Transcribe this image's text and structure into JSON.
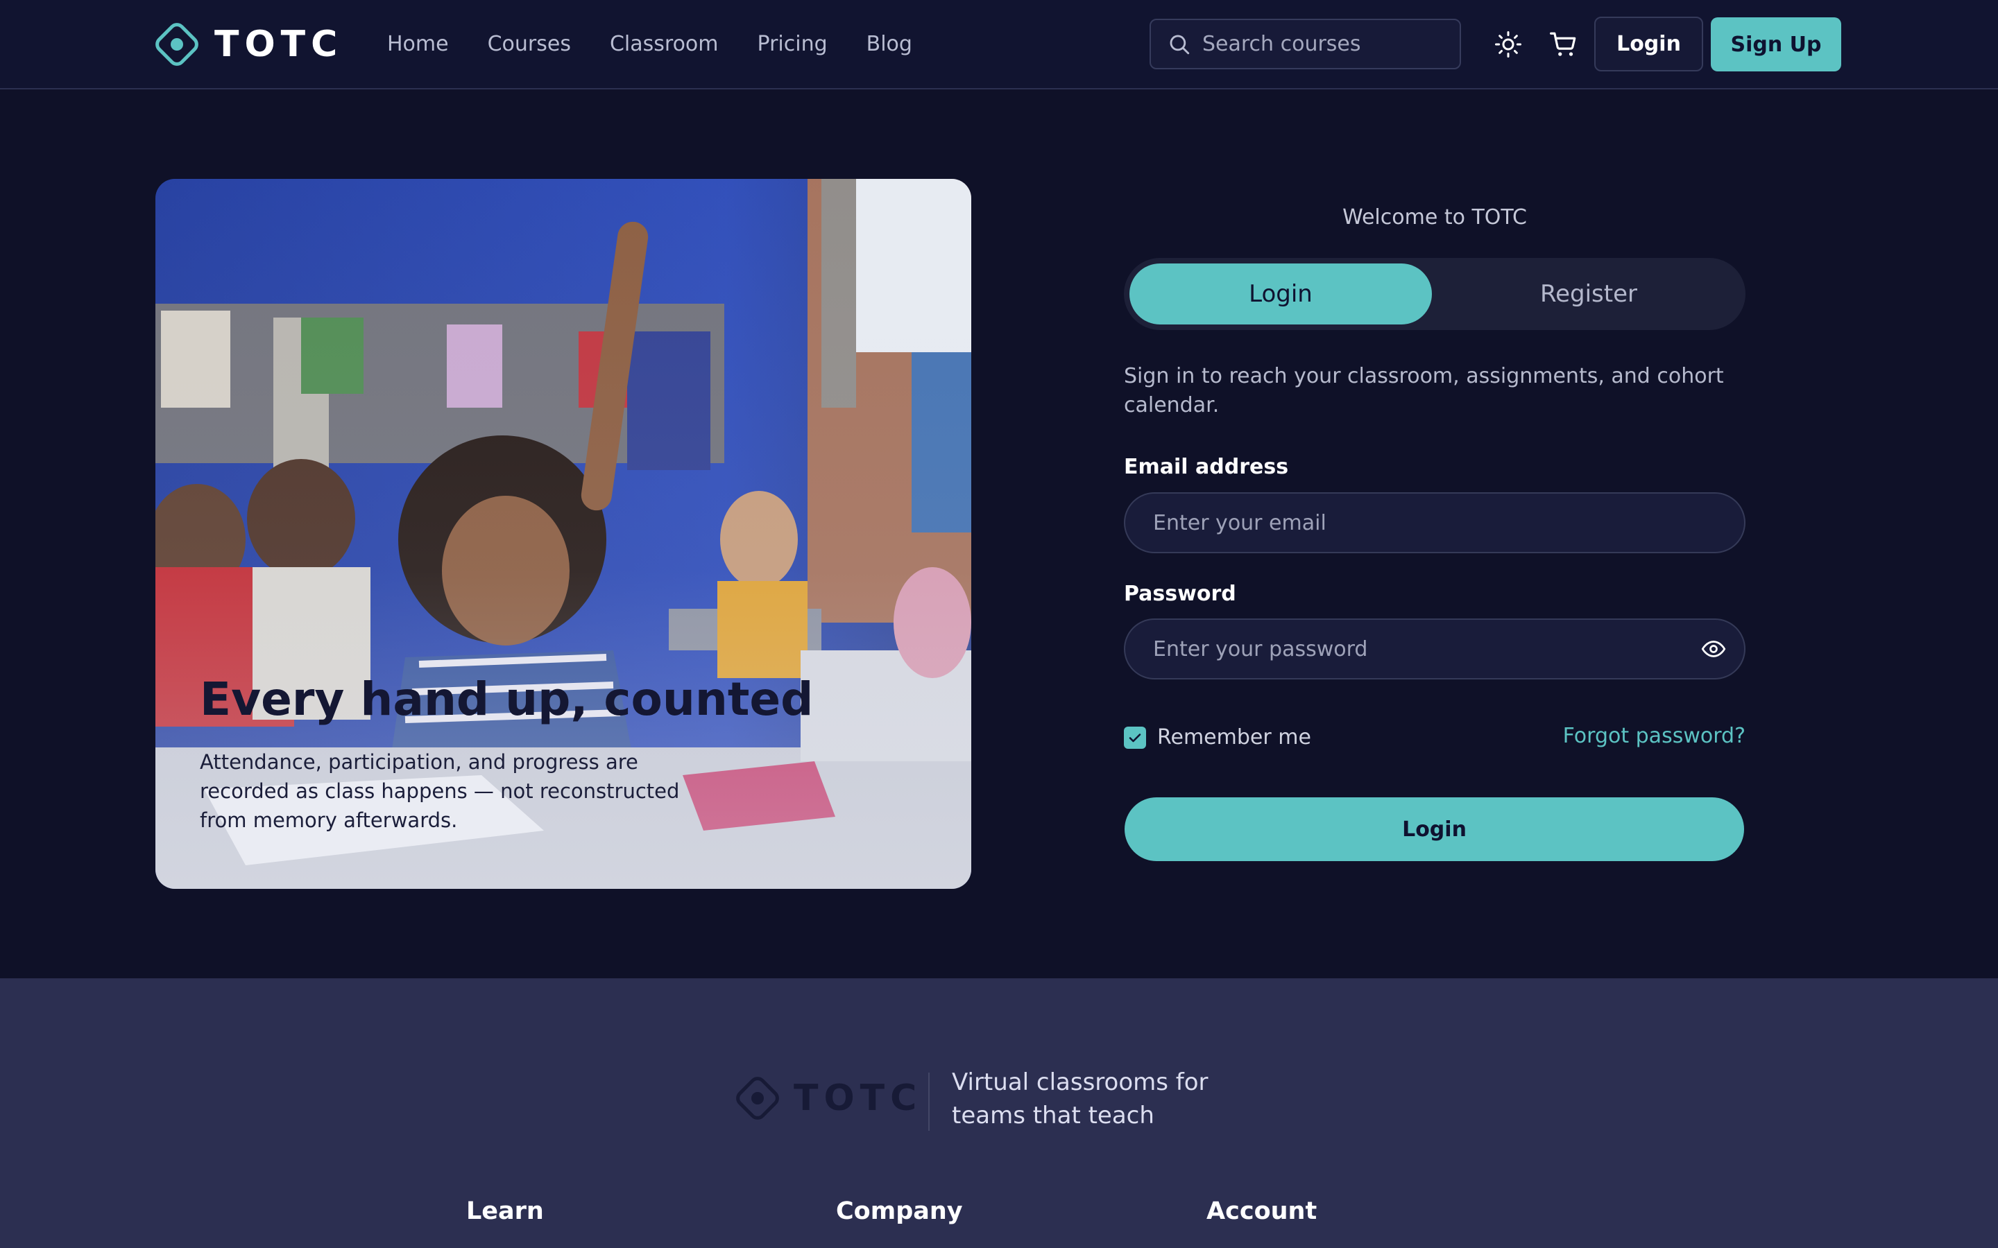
{
  "brand": {
    "name": "TOTC",
    "accent": "#5cc3c3",
    "background": "#0f1128",
    "footer_bg": "#2c2f51"
  },
  "nav": {
    "links": [
      "Home",
      "Courses",
      "Classroom",
      "Pricing",
      "Blog"
    ],
    "search_placeholder": "Search courses",
    "theme_icon": "sun-icon",
    "cart_icon": "cart-icon",
    "login_label": "Login",
    "signup_label": "Sign Up"
  },
  "hero": {
    "title": "Every hand up, counted",
    "subtitle": "Attendance, participation, and progress are recorded as class happens — not reconstructed from memory afterwards."
  },
  "auth": {
    "welcome": "Welcome to TOTC",
    "tabs": {
      "login": "Login",
      "register": "Register"
    },
    "intro": "Sign in to reach your classroom, assignments, and cohort calendar.",
    "email_label": "Email address",
    "email_placeholder": "Enter your email",
    "password_label": "Password",
    "password_placeholder": "Enter your password",
    "remember_label": "Remember me",
    "remember_checked": true,
    "forgot_label": "Forgot password?",
    "submit_label": "Login"
  },
  "footer": {
    "brand": "TOTC",
    "tagline": "Virtual classrooms for teams that teach",
    "columns": [
      "Learn",
      "Company",
      "Account"
    ]
  }
}
